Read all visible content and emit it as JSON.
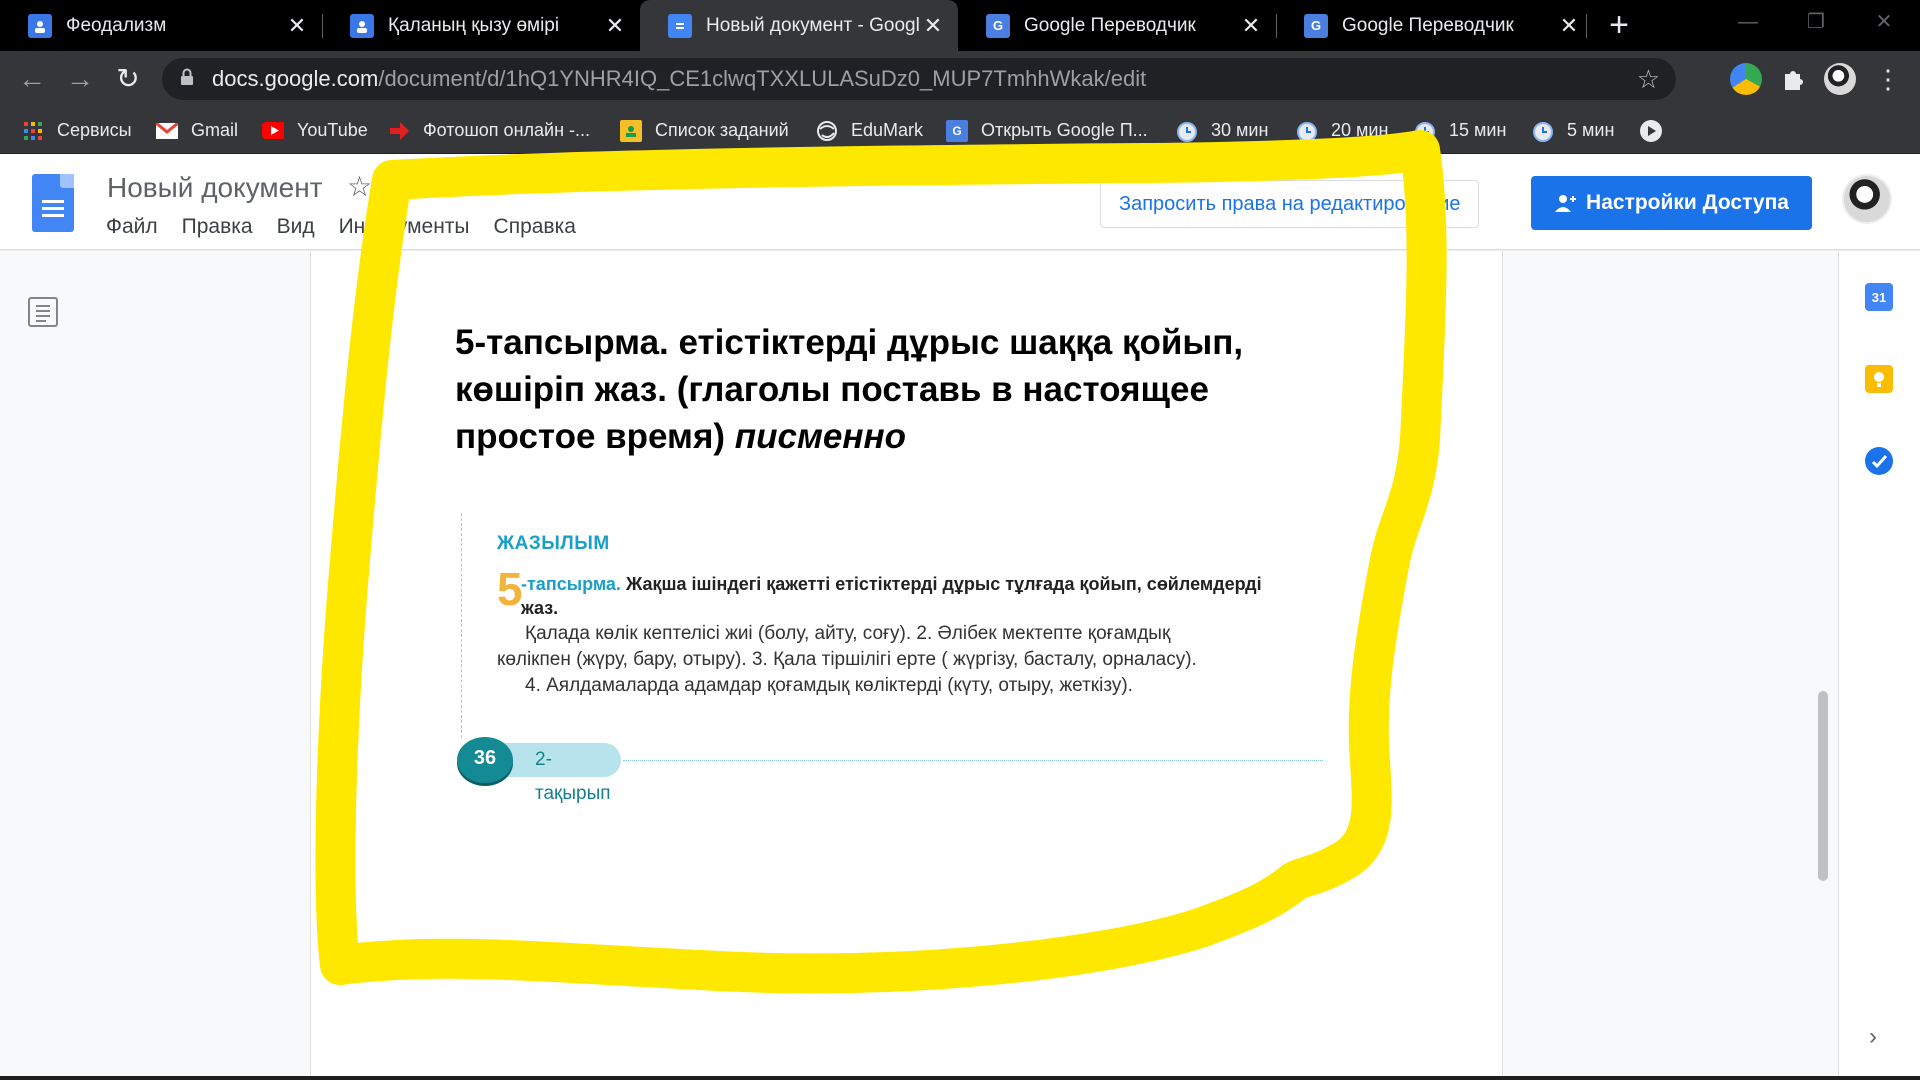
{
  "browser": {
    "tabs": [
      {
        "title": "Феодализм",
        "close": "✕"
      },
      {
        "title": "Қаланың қызу өмірі",
        "close": "✕"
      },
      {
        "title": "Новый документ - Google",
        "close": "✕"
      },
      {
        "title": "Google Переводчик",
        "close": "✕"
      },
      {
        "title": "Google Переводчик",
        "close": "✕"
      }
    ],
    "new_tab": "+",
    "url_host": "docs.google.com",
    "url_path": "/document/d/1hQ1YNHR4IQ_CE1clwqTXXLULASuDz0_MUP7TmhhWkak/edit",
    "bookmarks": [
      "Сервисы",
      "Gmail",
      "YouTube",
      "Фотошоп онлайн -...",
      "Список заданий",
      "EduMark",
      "Открыть Google П...",
      "30 мин",
      "20 мин",
      "15 мин",
      "5 мин"
    ]
  },
  "docs": {
    "title": "Новый документ",
    "menu": [
      "Файл",
      "Правка",
      "Вид",
      "Инструменты",
      "Справка"
    ],
    "request_edit": "Запросить права на редактирование",
    "share": "Настройки Доступа"
  },
  "document": {
    "heading_line": "5-тапсырма. етістіктерді дұрыс шаққа қойып, көшіріп жаз. (глаголы поставь в  настоящее простое время)",
    "heading_italic": "писменно",
    "book": {
      "section": "ЖАЗЫЛЫМ",
      "number": "5",
      "task_label": "-тапсырма.",
      "task_text": "Жақша ішіндегі қажетті етістіктерді дұрыс тұлғада қойып, сөйлемдерді жаз.",
      "line1": "Қалада көлік кептелісі жиі (болу, айту, соғу). 2. Әлібек мектепте қоғамдық",
      "line2": "көлікпен (жүру, бару, отыру). 3. Қала тіршілігі ерте ( жүргізу, басталу, орналасу).",
      "line3": "4. Аялдамаларда адамдар қоғамдық көліктерді (күту, отыру, жеткізу).",
      "page": "36",
      "topic": "2-тақырып"
    }
  },
  "side_panel": {
    "calendar_day": "31"
  },
  "colors": {
    "docs_blue": "#1a73e8",
    "highlight_yellow": "#ffe800",
    "book_cyan": "#1aa0c8",
    "book_orange": "#f3b23a"
  },
  "icons": [
    "back-icon",
    "forward-icon",
    "reload-icon",
    "lock-icon",
    "star-icon",
    "extensions-icon",
    "profile-icon",
    "kebab-menu-icon",
    "docs-logo-icon",
    "outline-icon",
    "calendar-icon",
    "keep-icon",
    "tasks-icon",
    "chevron-right-icon"
  ]
}
